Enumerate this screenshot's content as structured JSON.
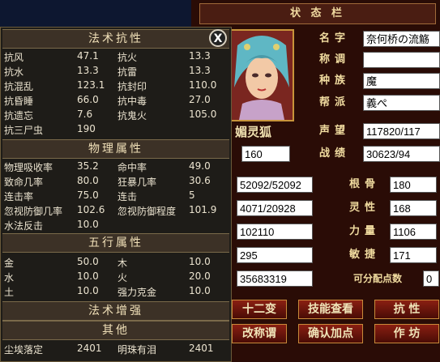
{
  "status_window": {
    "title": "状 态 栏",
    "name_label": "名字",
    "name_value": "奈何桥の流觞",
    "title_label": "称调",
    "title_value": "",
    "race_label": "种族",
    "race_value": "魔",
    "guild_label": "帮派",
    "guild_value": "義ぺ",
    "char_name": "媚灵狐",
    "prestige_label": "声望",
    "prestige_value": "117820/117",
    "level_value": "160",
    "merit_label": "战绩",
    "merit_value": "30623/94",
    "hp_value": "52092/52092",
    "mp_value": "4071/20928",
    "exp_value": "102110",
    "stat4_value": "295",
    "money_value": "35683319",
    "bone_label": "根骨",
    "bone_value": "180",
    "spirit_label": "灵性",
    "spirit_value": "168",
    "str_label": "力量",
    "str_value": "1106",
    "agi_label": "敏捷",
    "agi_value": "171",
    "points_label": "可分配点数",
    "points_value": "0",
    "buttons": {
      "twelve": "十二变",
      "skills": "技能查看",
      "resist": "抗 性",
      "rename": "改称谓",
      "confirm": "确认加点",
      "operate": "作 坊"
    }
  },
  "resist_panel": {
    "close": "X",
    "magic_header": "法术抗性",
    "magic_rows": [
      [
        "抗风",
        "47.1",
        "抗火",
        "13.3"
      ],
      [
        "抗水",
        "13.3",
        "抗雷",
        "13.3"
      ],
      [
        "抗混乱",
        "123.1",
        "抗封印",
        "110.0"
      ],
      [
        "抗昏睡",
        "66.0",
        "抗中毒",
        "27.0"
      ],
      [
        "抗遗忘",
        "7.6",
        "抗鬼火",
        "105.0"
      ],
      [
        "抗三尸虫",
        "190",
        "",
        ""
      ]
    ],
    "phys_header": "物理属性",
    "phys_rows": [
      [
        "物理吸收率",
        "35.2",
        "命中率",
        "49.0"
      ],
      [
        "致命几率",
        "80.0",
        "狂暴几率",
        "30.6"
      ],
      [
        "连击率",
        "75.0",
        "连击",
        "5"
      ],
      [
        "忽视防御几率",
        "102.6",
        "忽视防御程度",
        "101.9"
      ],
      [
        "水法反击",
        "10.0",
        "",
        ""
      ]
    ],
    "elem_header": "五行属性",
    "elem_rows": [
      [
        "金",
        "50.0",
        "木",
        "10.0"
      ],
      [
        "水",
        "10.0",
        "火",
        "20.0"
      ],
      [
        "土",
        "10.0",
        "强力克金",
        "10.0"
      ]
    ],
    "boost_header": "法术增强",
    "other_header": "其他",
    "other_rows": [
      [
        "尘埃落定",
        "2401",
        "明珠有泪",
        "2401"
      ]
    ]
  }
}
